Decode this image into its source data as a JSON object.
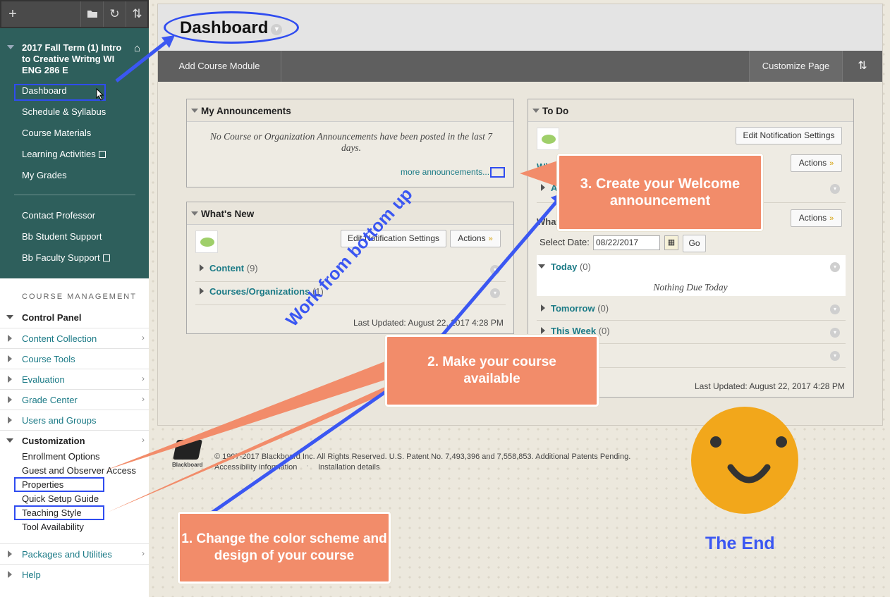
{
  "nav": {
    "toolbar_icons": [
      "plus-icon",
      "folder-icon",
      "refresh-icon",
      "sort-icon"
    ],
    "toolbar_plus": "+",
    "course_title": "2017 Fall Term (1) Intro to Creative Writng WI ENG 286 E",
    "links": [
      "Dashboard",
      "Schedule & Syllabus",
      "Course Materials",
      "Learning Activities",
      "My Grades"
    ],
    "links2": [
      "Contact Professor",
      "Bb Student Support",
      "Bb Faculty Support"
    ]
  },
  "management": {
    "heading": "COURSE MANAGEMENT",
    "control_panel": "Control Panel",
    "items": [
      "Content Collection",
      "Course Tools",
      "Evaluation",
      "Grade Center",
      "Users and Groups"
    ],
    "customization": "Customization",
    "sub_items": [
      "Enrollment Options",
      "Guest and Observer Access",
      "Properties",
      "Quick Setup Guide",
      "Teaching Style",
      "Tool Availability"
    ],
    "packages": "Packages and Utilities",
    "help": "Help"
  },
  "header": {
    "title": "Dashboard"
  },
  "toolbar": {
    "add_module": "Add Course Module",
    "customize": "Customize Page",
    "sort_icon": "⇅"
  },
  "announcements": {
    "title": "My Announcements",
    "empty": "No Course or Organization Announcements have been posted in the last 7 days.",
    "more": "more announcements..."
  },
  "whatsnew": {
    "title": "What's New",
    "edit_btn": "Edit Notification Settings",
    "actions_btn": "Actions",
    "rows": [
      {
        "label": "Content",
        "count": "(9)"
      },
      {
        "label": "Courses/Organizations",
        "count": "(1)"
      }
    ],
    "updated": "Last Updated: August 22, 2017 4:28 PM"
  },
  "todo": {
    "title": "To Do",
    "edit_btn": "Edit Notification Settings",
    "actions_btn": "Actions",
    "select_label": "Select Date:",
    "date_value": "08/22/2017",
    "go_btn": "Go",
    "today": "Today",
    "today_count": "(0)",
    "nothing_due": "Nothing Due Today",
    "tomorrow": "Tomorrow",
    "tomorrow_count": "(0)",
    "this_week": "This Week",
    "this_week_count": "(0)",
    "partial_a": "A",
    "partial_wh": "Wh",
    "partial_what": "What",
    "updated": "Last Updated: August 22, 2017 4:28 PM"
  },
  "footer": {
    "copyright": "© 1997-2017 Blackboard Inc. All Rights Reserved. U.S. Patent No. 7,493,396 and 7,558,853. Additional Patents Pending.",
    "accessibility": "Accessibility information",
    "installation": "Installation details",
    "logo_text": "Blackboard"
  },
  "annotations": {
    "step1": "1. Change the color scheme and design of your course",
    "step2": "2. Make your course available",
    "step3": "3. Create your Welcome announcement",
    "work": "Work from bottom up",
    "the_end": "The End",
    "colors": {
      "callout": "#f28c6a",
      "highlight": "#2f4cf0",
      "smiley": "#f2a71b"
    }
  }
}
